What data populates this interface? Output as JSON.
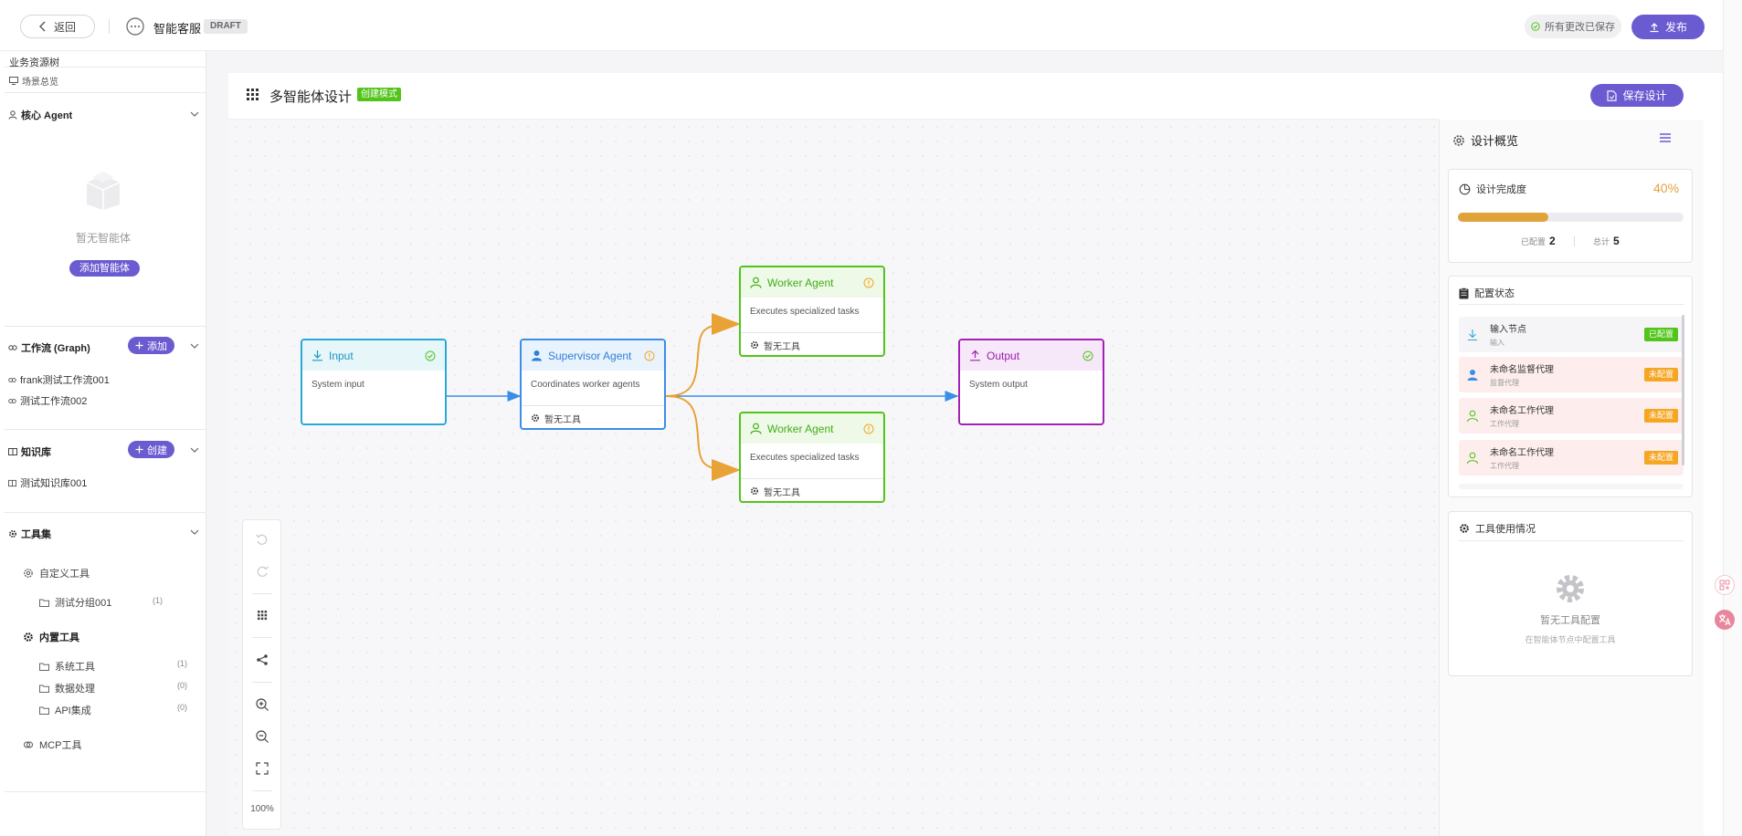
{
  "header": {
    "back_label": "返回",
    "app_name": "智能客服",
    "draft_badge": "DRAFT",
    "saved_status": "所有更改已保存",
    "publish_label": "发布"
  },
  "sidebar": {
    "title": "业务资源树",
    "scene_overview": "场景总览",
    "core_agent": {
      "heading": "核心 Agent",
      "empty_text": "暂无智能体",
      "add_button": "添加智能体"
    },
    "workflow": {
      "heading": "工作流 (Graph)",
      "add_button": "添加",
      "items": [
        "frank测试工作流001",
        "测试工作流002"
      ]
    },
    "knowledge": {
      "heading": "知识库",
      "create_button": "创建",
      "items": [
        "测试知识库001"
      ]
    },
    "toolset": {
      "heading": "工具集",
      "custom_tools": {
        "label": "自定义工具",
        "groups": [
          {
            "name": "测试分组001",
            "count": "(1)"
          }
        ]
      },
      "builtin_tools": {
        "label": "内置工具",
        "groups": [
          {
            "name": "系统工具",
            "count": "(1)"
          },
          {
            "name": "数据处理",
            "count": "(0)"
          },
          {
            "name": "API集成",
            "count": "(0)"
          }
        ]
      },
      "mcp_tools": {
        "label": "MCP工具"
      }
    }
  },
  "main": {
    "title": "多智能体设计",
    "mode_badge": "创建模式",
    "save_button": "保存设计",
    "zoom": "100%",
    "nodes": {
      "input": {
        "title": "Input",
        "desc": "System input"
      },
      "supervisor": {
        "title": "Supervisor Agent",
        "desc": "Coordinates worker agents",
        "tools": "暂无工具"
      },
      "worker1": {
        "title": "Worker Agent",
        "desc": "Executes specialized tasks",
        "tools": "暂无工具"
      },
      "worker2": {
        "title": "Worker Agent",
        "desc": "Executes specialized tasks",
        "tools": "暂无工具"
      },
      "output": {
        "title": "Output",
        "desc": "System output"
      }
    }
  },
  "right_panel": {
    "title": "设计概览",
    "completion": {
      "label": "设计完成度",
      "percent": "40%",
      "progress_fraction": 0.4,
      "configured_label": "已配置",
      "configured_value": "2",
      "total_label": "总计",
      "total_value": "5"
    },
    "config_status": {
      "heading": "配置状态",
      "rows": [
        {
          "name": "输入节点",
          "sub": "输入",
          "badge": "已配置"
        },
        {
          "name": "未命名监督代理",
          "sub": "监督代理",
          "badge": "未配置"
        },
        {
          "name": "未命名工作代理",
          "sub": "工作代理",
          "badge": "未配置"
        },
        {
          "name": "未命名工作代理",
          "sub": "工作代理",
          "badge": "未配置"
        }
      ]
    },
    "tool_usage": {
      "heading": "工具使用情况",
      "empty_text": "暂无工具配置",
      "empty_hint": "在智能体节点中配置工具"
    }
  },
  "colors": {
    "accent": "#6b5bd1",
    "input_node": "#29a8d8",
    "supervisor_node": "#3b8de8",
    "worker_node": "#52c41a",
    "output_node": "#a321b5",
    "warning": "#f5a623",
    "progress": "#e0a33a"
  }
}
